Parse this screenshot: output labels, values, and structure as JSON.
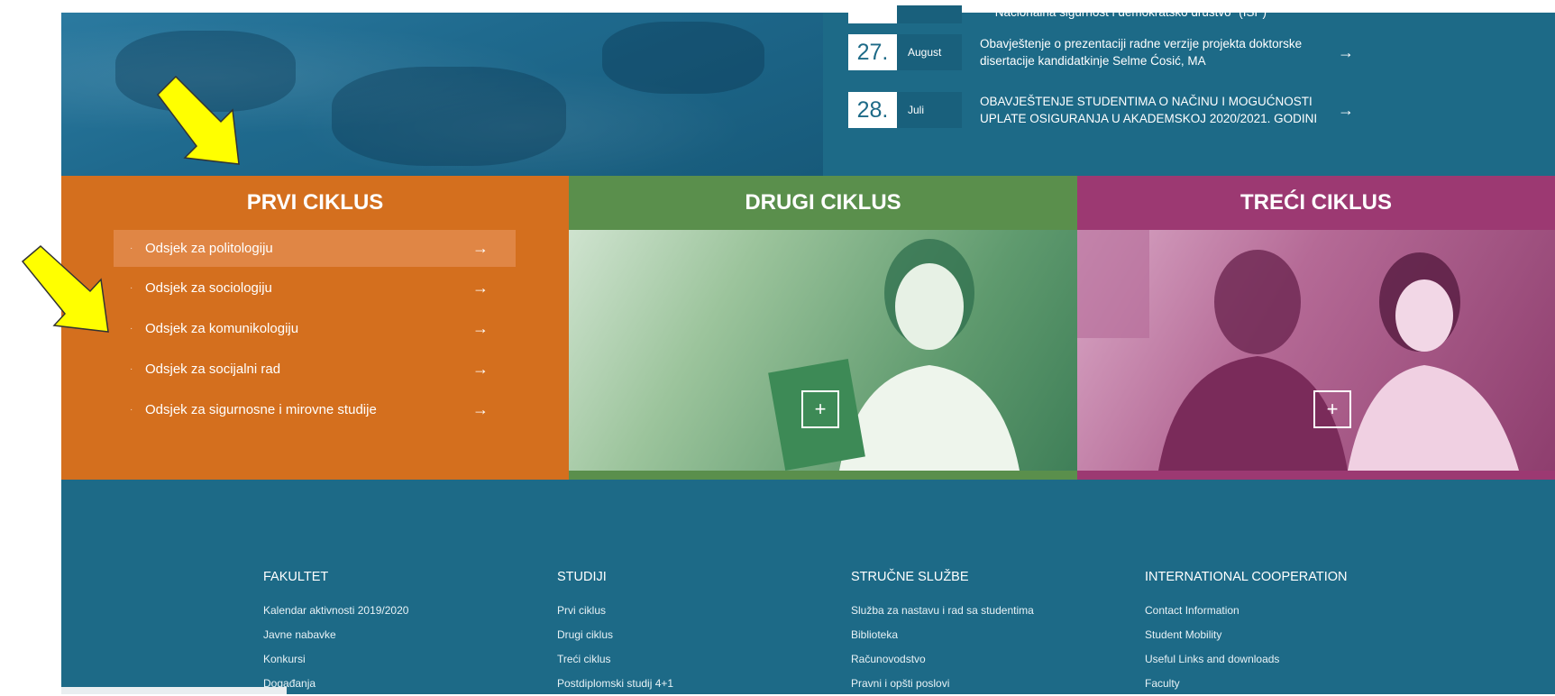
{
  "news": {
    "top_partial": "\"Nacionalna sigurnost i demokratsko društvo\" (ISP)",
    "items": [
      {
        "day": "27.",
        "month": "August",
        "text": "Obavještenje o prezentaciji radne verzije projekta doktorske disertacije kandidatkinje Selme Ćosić, MA"
      },
      {
        "day": "28.",
        "month": "Juli",
        "text": "OBAVJEŠTENJE STUDENTIMA O NAČINU I MOGUĆNOSTI UPLATE OSIGURANJA U AKADEMSKOJ 2020/2021. GODINI"
      }
    ]
  },
  "cycles": {
    "first": {
      "title": "PRVI CIKLUS",
      "departments": [
        "Odsjek za politologiju",
        "Odsjek za sociologiju",
        "Odsjek za komunikologiju",
        "Odsjek za socijalni rad",
        "Odsjek za sigurnosne i mirovne studije"
      ]
    },
    "second": {
      "title": "DRUGI CIKLUS",
      "plus": "+"
    },
    "third": {
      "title": "TREĆI CIKLUS",
      "plus": "+"
    }
  },
  "footer": {
    "columns": [
      {
        "heading": "FAKULTET",
        "links": [
          "Kalendar aktivnosti 2019/2020",
          "Javne nabavke",
          "Konkursi",
          "Događanja"
        ]
      },
      {
        "heading": "STUDIJI",
        "links": [
          "Prvi ciklus",
          "Drugi ciklus",
          "Treći ciklus",
          "Postdiplomski studij 4+1"
        ]
      },
      {
        "heading": "STRUČNE SLUŽBE",
        "links": [
          "Služba za nastavu i rad sa studentima",
          "Biblioteka",
          "Računovodstvo",
          "Pravni i opšti poslovi"
        ]
      },
      {
        "heading": "INTERNATIONAL COOPERATION",
        "links": [
          "Contact Information",
          "Student Mobility",
          "Useful Links and downloads",
          "Faculty"
        ]
      }
    ]
  },
  "icons": {
    "arrow": "→",
    "dot": "·"
  },
  "colors": {
    "page_bg": "#1d6a87",
    "first_cycle": "#d46f1e",
    "second_cycle": "#5a8f4c",
    "third_cycle": "#9c3972",
    "annotation_arrow": "#ffff00"
  }
}
